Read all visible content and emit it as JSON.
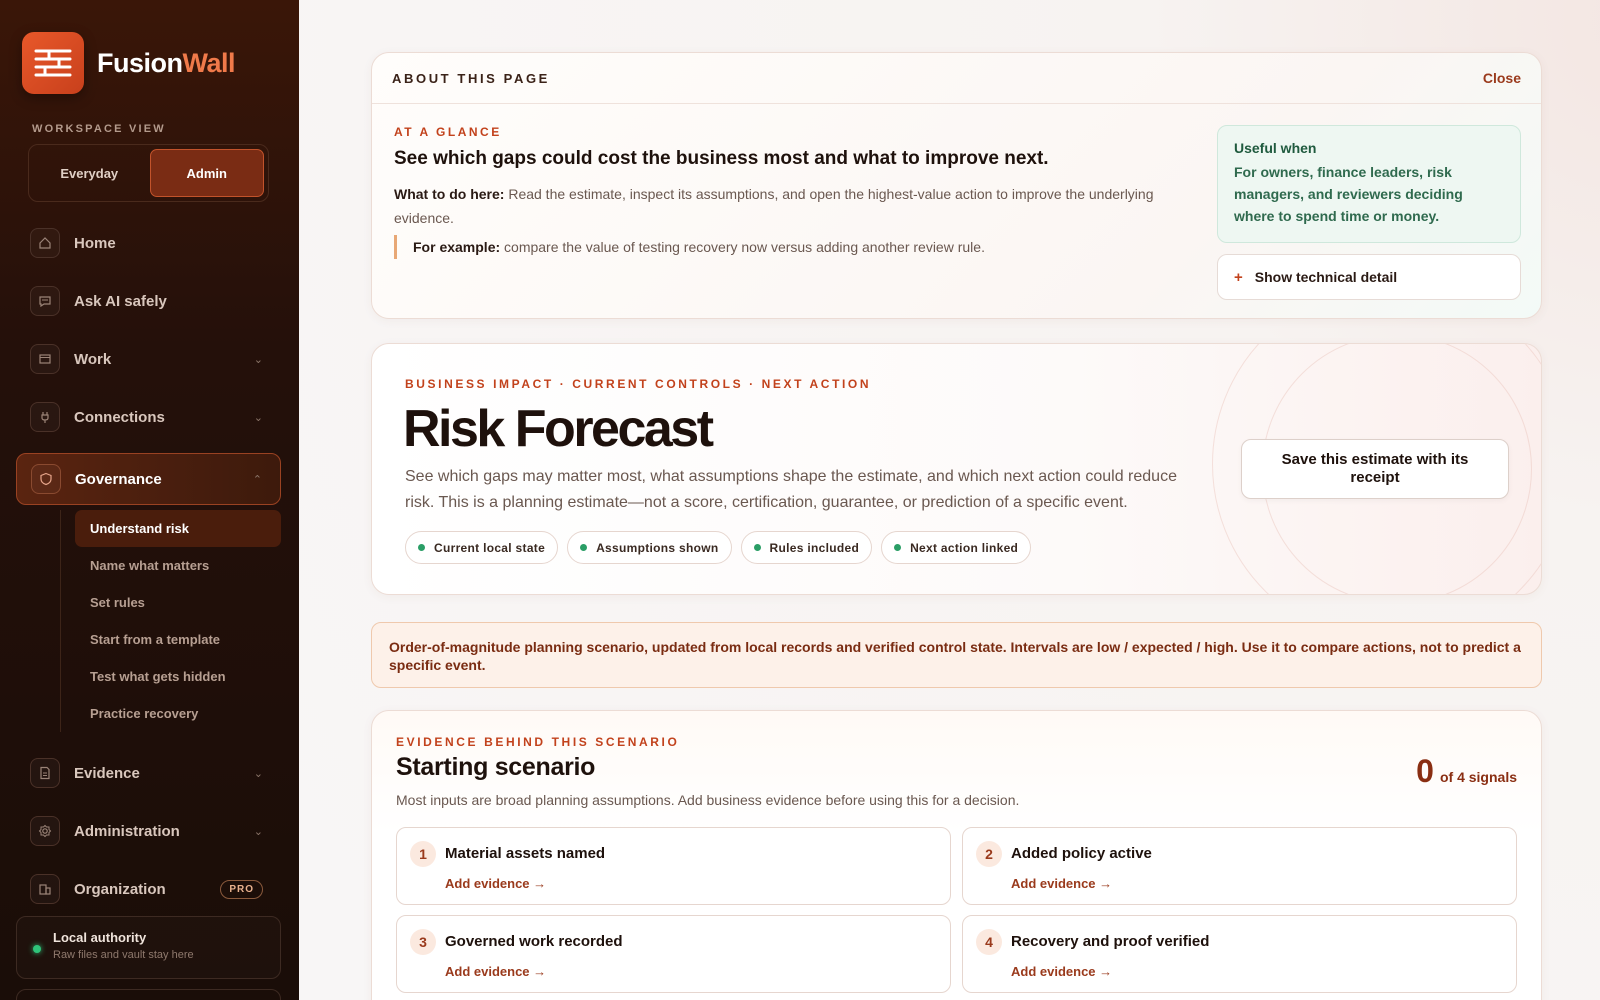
{
  "brand": {
    "name_part1": "Fusion",
    "name_part2": "Wall"
  },
  "workspace": {
    "label": "WORKSPACE VIEW",
    "options": [
      "Everyday",
      "Admin"
    ],
    "selected": "Admin"
  },
  "nav": [
    {
      "label": "Home",
      "icon": "home-icon"
    },
    {
      "label": "Ask AI safely",
      "icon": "chat-icon"
    },
    {
      "label": "Work",
      "icon": "folder-icon",
      "expandable": true
    },
    {
      "label": "Connections",
      "icon": "plug-icon",
      "expandable": true
    },
    {
      "label": "Governance",
      "icon": "shield-icon",
      "expanded": true
    },
    {
      "label": "Evidence",
      "icon": "document-icon",
      "expandable": true
    },
    {
      "label": "Administration",
      "icon": "gear-icon",
      "expandable": true
    },
    {
      "label": "Organization",
      "icon": "building-icon",
      "badge": "PRO"
    }
  ],
  "subnav": [
    "Understand risk",
    "Name what matters",
    "Set rules",
    "Start from a template",
    "Test what gets hidden",
    "Practice recovery"
  ],
  "authority": {
    "title": "Local authority",
    "subtitle": "Raw files and vault stay here"
  },
  "about": {
    "title": "ABOUT THIS PAGE",
    "close": "Close",
    "glance_label": "AT A GLANCE",
    "headline": "See which gaps could cost the business most and what to improve next.",
    "todo_label": "What to do here:",
    "todo_text": " Read the estimate, inspect its assumptions, and open the highest-value action to improve the underlying evidence.",
    "example_label": "For example:",
    "example_text": " compare the value of testing recovery now versus adding another review rule.",
    "useful_title": "Useful when",
    "useful_text": "For owners, finance leaders, risk managers, and reviewers deciding where to spend time or money.",
    "tech_detail": "Show technical detail"
  },
  "risk": {
    "label": "BUSINESS IMPACT · CURRENT CONTROLS · NEXT ACTION",
    "title": "Risk Forecast",
    "description": "See which gaps may matter most, what assumptions shape the estimate, and which next action could reduce risk. This is a planning estimate—not a score, certification, guarantee, or prediction of a specific event.",
    "pills": [
      "Current local state",
      "Assumptions shown",
      "Rules included",
      "Next action linked"
    ],
    "save_button": "Save this estimate with its receipt"
  },
  "notice": "Order-of-magnitude planning scenario, updated from local records and verified control state. Intervals are low / expected / high. Use it to compare actions, not to predict a specific event.",
  "evidence": {
    "label": "EVIDENCE BEHIND THIS SCENARIO",
    "title": "Starting scenario",
    "description": "Most inputs are broad planning assumptions. Add business evidence before using this for a decision.",
    "signals_count": "0",
    "signals_text": "of 4 signals",
    "items": [
      {
        "num": "1",
        "name": "Material assets named",
        "action": "Add evidence →"
      },
      {
        "num": "2",
        "name": "Added policy active",
        "action": "Add evidence →"
      },
      {
        "num": "3",
        "name": "Governed work recorded",
        "action": "Add evidence →"
      },
      {
        "num": "4",
        "name": "Recovery and proof verified",
        "action": "Add evidence →"
      }
    ]
  },
  "colors": {
    "accent": "#c2421c",
    "sidebar_bg": "#24100a",
    "success": "#2a9e66"
  }
}
